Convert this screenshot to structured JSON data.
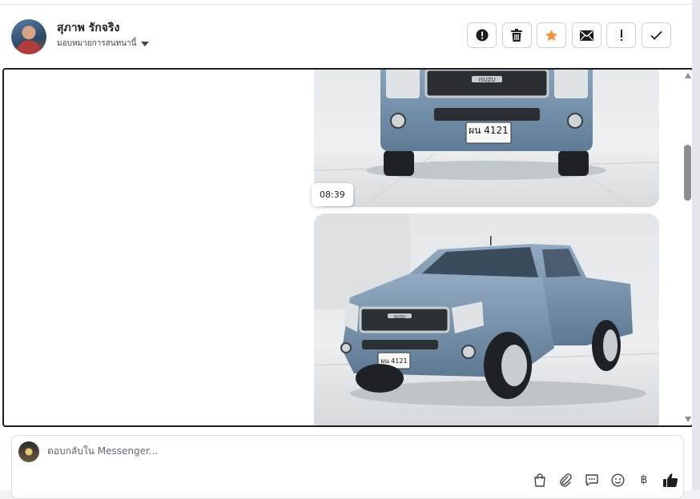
{
  "contact": {
    "name": "สุภาพ รักจริง",
    "assign_label": "มอบหมายการสนทนานี้"
  },
  "actions": [
    {
      "name": "report-spam",
      "icon": "exclamation-circle-icon"
    },
    {
      "name": "delete",
      "icon": "trash-icon"
    },
    {
      "name": "star",
      "icon": "star-icon",
      "color": "#f7923a"
    },
    {
      "name": "mark-unread",
      "icon": "envelope-icon"
    },
    {
      "name": "follow-up",
      "icon": "exclamation-icon"
    },
    {
      "name": "mark-done",
      "icon": "checkmark-icon"
    }
  ],
  "messages": {
    "timestamp": "08:39",
    "images": [
      {
        "plate": "ผน 4121",
        "brand": "ISUZU",
        "view": "front"
      },
      {
        "plate": "ผน 4121",
        "brand": "ISUZU",
        "view": "three-quarter"
      }
    ]
  },
  "composer": {
    "placeholder": "ตอบกลับใน Messenger...",
    "tools": [
      "shopping-bag-icon",
      "paperclip-icon",
      "chat-bubble-icon",
      "emoji-icon",
      "baht-icon",
      "thumbs-up-icon"
    ],
    "baht_symbol": "฿"
  }
}
